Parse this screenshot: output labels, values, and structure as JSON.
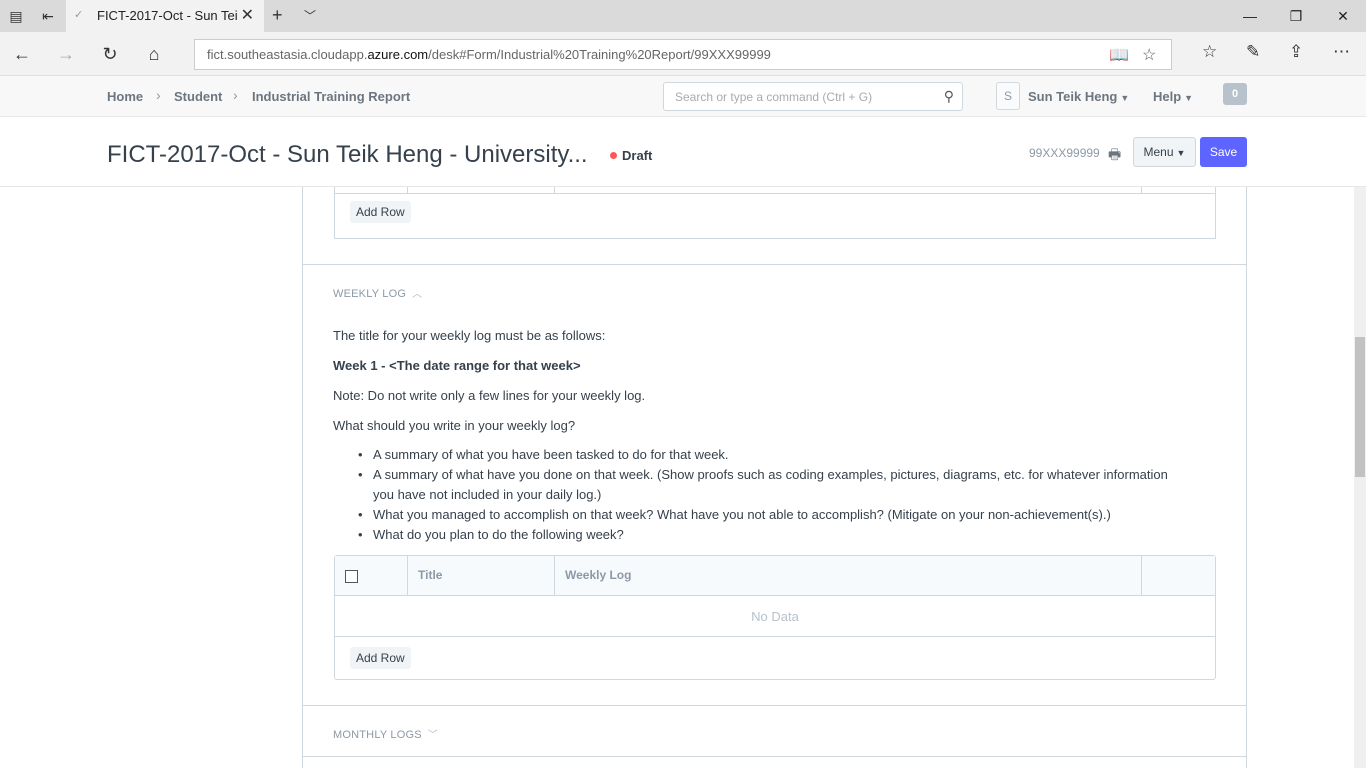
{
  "browser": {
    "tab_title": "FICT-2017-Oct - Sun Tei",
    "url_prefix": "fict.southeastasia.cloudapp.",
    "url_domain": "azure.com",
    "url_suffix": "/desk#Form/Industrial%20Training%20Report/99XXX99999"
  },
  "header": {
    "breadcrumbs": [
      "Home",
      "Student",
      "Industrial Training Report"
    ],
    "search_placeholder": "Search or type a command (Ctrl + G)",
    "avatar_letter": "S",
    "user_name": "Sun Teik Heng",
    "help_label": "Help",
    "notification_count": "0"
  },
  "titlebar": {
    "title": "FICT-2017-Oct - Sun Teik Heng - University...",
    "status": "Draft",
    "doc_name": "99XXX99999",
    "menu_label": "Menu",
    "save_label": "Save"
  },
  "prev_section": {
    "add_row_label": "Add Row"
  },
  "weekly_log": {
    "heading": "WEEKLY LOG",
    "intro": "The title for your weekly log must be as follows:",
    "format": "Week 1 - <The date range for that week>",
    "note": "Note: Do not write only a few lines for your weekly log.",
    "question": "What should you write in your weekly log?",
    "bullets": [
      "A summary of what you have been tasked to do for that week.",
      "A summary of what have you done on that week. (Show proofs such as coding examples, pictures, diagrams, etc. for whatever information you have not included in your daily log.)",
      "What you managed to accomplish on that week? What have you not able to accomplish? (Mitigate on your non-achievement(s).)",
      "What do you plan to do the following week?"
    ],
    "grid": {
      "columns": [
        "Title",
        "Weekly Log"
      ],
      "empty_text": "No Data",
      "add_row_label": "Add Row"
    }
  },
  "monthly_logs": {
    "heading": "MONTHLY LOGS"
  },
  "colors": {
    "primary": "#5e64ff",
    "draft_dot": "#ff5858",
    "border": "#d1d8dd",
    "muted_text": "#8d99a6"
  }
}
